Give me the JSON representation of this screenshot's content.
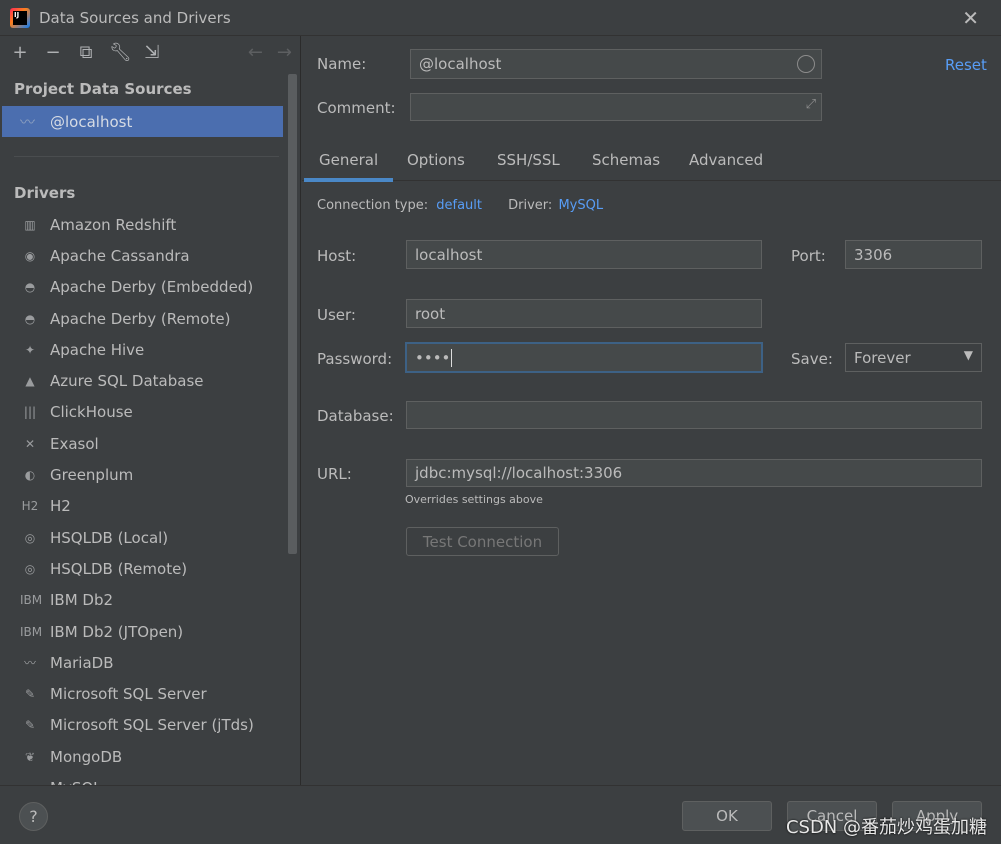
{
  "window": {
    "title": "Data Sources and Drivers",
    "app_icon_text": "IJ"
  },
  "toolbar": {
    "add": "+",
    "remove": "−",
    "copy": "⧉",
    "settings": "🔧",
    "import": "⇲",
    "back": "←",
    "forward": "→"
  },
  "sidebar": {
    "project_header": "Project Data Sources",
    "project_items": [
      {
        "label": "@localhost",
        "icon": "mysql-dolphin-icon"
      }
    ],
    "drivers_header": "Drivers",
    "drivers": [
      {
        "label": "Amazon Redshift",
        "icon": "▥"
      },
      {
        "label": "Apache Cassandra",
        "icon": "◉"
      },
      {
        "label": "Apache Derby (Embedded)",
        "icon": "◓"
      },
      {
        "label": "Apache Derby (Remote)",
        "icon": "◓"
      },
      {
        "label": "Apache Hive",
        "icon": "✦"
      },
      {
        "label": "Azure SQL Database",
        "icon": "▲"
      },
      {
        "label": "ClickHouse",
        "icon": "|||"
      },
      {
        "label": "Exasol",
        "icon": "✕"
      },
      {
        "label": "Greenplum",
        "icon": "◐"
      },
      {
        "label": "H2",
        "icon": "H2"
      },
      {
        "label": "HSQLDB (Local)",
        "icon": "◎"
      },
      {
        "label": "HSQLDB (Remote)",
        "icon": "◎"
      },
      {
        "label": "IBM Db2",
        "icon": "IBM"
      },
      {
        "label": "IBM Db2 (JTOpen)",
        "icon": "IBM"
      },
      {
        "label": "MariaDB",
        "icon": "〰"
      },
      {
        "label": "Microsoft SQL Server",
        "icon": "✎"
      },
      {
        "label": "Microsoft SQL Server (jTds)",
        "icon": "✎"
      },
      {
        "label": "MongoDB",
        "icon": "❦"
      },
      {
        "label": "MySQL",
        "icon": "〰"
      }
    ]
  },
  "form": {
    "name_label": "Name:",
    "name_value": "@localhost",
    "comment_label": "Comment:",
    "comment_value": "",
    "reset": "Reset",
    "tabs": [
      "General",
      "Options",
      "SSH/SSL",
      "Schemas",
      "Advanced"
    ],
    "active_tab": "General",
    "connection_type_label": "Connection type:",
    "connection_type": "default",
    "driver_label": "Driver:",
    "driver": "MySQL",
    "host_label": "Host:",
    "host": "localhost",
    "port_label": "Port:",
    "port": "3306",
    "user_label": "User:",
    "user": "root",
    "password_label": "Password:",
    "password": "••••",
    "save_label": "Save:",
    "save_value": "Forever",
    "database_label": "Database:",
    "database": "",
    "url_label": "URL:",
    "url": "jdbc:mysql://localhost:3306",
    "url_hint": "Overrides settings above",
    "test_connection": "Test Connection"
  },
  "footer": {
    "help": "?",
    "ok": "OK",
    "cancel": "Cancel",
    "apply": "Apply"
  },
  "watermark": "CSDN @番茄炒鸡蛋加糖",
  "colors": {
    "accent": "#4a88c7",
    "selection": "#4b6eaf",
    "link": "#589df6",
    "background": "#3c3f41"
  }
}
